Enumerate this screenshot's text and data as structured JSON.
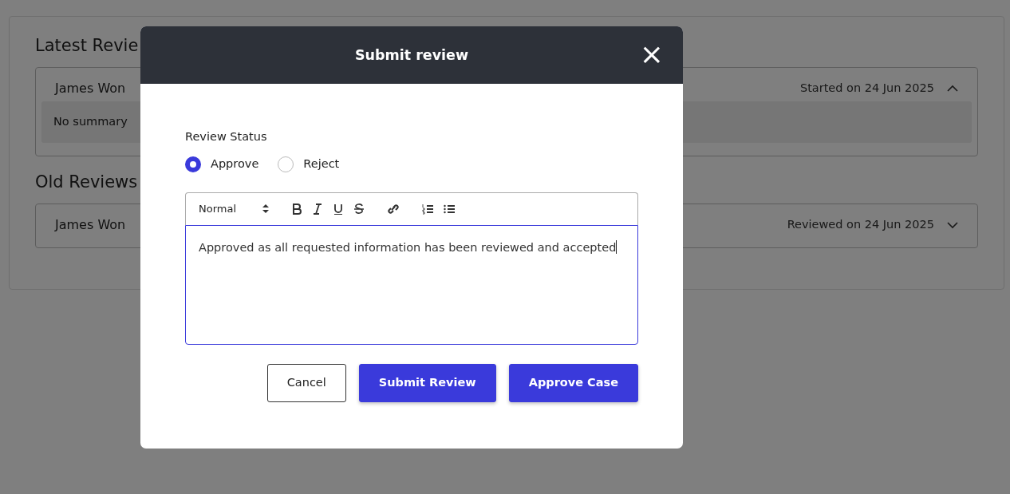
{
  "page": {
    "latest_title": "Latest Revie",
    "latest_reviews": [
      {
        "reviewer": "James Won",
        "date": "Started on 24 Jun 2025",
        "expanded": true,
        "summary": "No summary"
      }
    ],
    "old_title": "Old Reviews",
    "old_reviews": [
      {
        "reviewer": "James Won",
        "date": "Reviewed on 24 Jun 2025",
        "expanded": false
      }
    ]
  },
  "modal": {
    "title": "Submit review",
    "close": "×",
    "status_label": "Review Status",
    "options": [
      {
        "label": "Approve",
        "selected": true
      },
      {
        "label": "Reject",
        "selected": false
      }
    ],
    "editor": {
      "format": "Normal",
      "text": "Approved as all requested information has been reviewed and accepted"
    },
    "buttons": [
      {
        "label": "Cancel",
        "kind": "outline"
      },
      {
        "label": "Submit Review",
        "kind": "primary"
      },
      {
        "label": "Approve Case",
        "kind": "primary"
      }
    ]
  }
}
